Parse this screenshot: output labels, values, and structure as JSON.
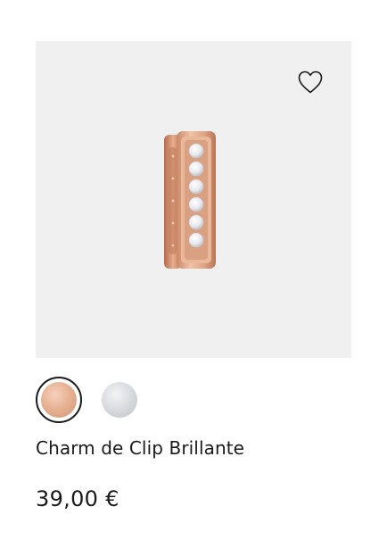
{
  "product": {
    "name": "Charm de Clip Brillante",
    "price": "39,00 €"
  },
  "wishlist": {
    "icon": "heart-outline-icon"
  },
  "swatches": [
    {
      "name": "rose-gold",
      "color": "#e2a98a",
      "selected": true
    },
    {
      "name": "silver",
      "color": "#d6d8db",
      "selected": false
    }
  ],
  "colors": {
    "image_background": "#f0f0f0",
    "text": "#1a1a1a"
  }
}
